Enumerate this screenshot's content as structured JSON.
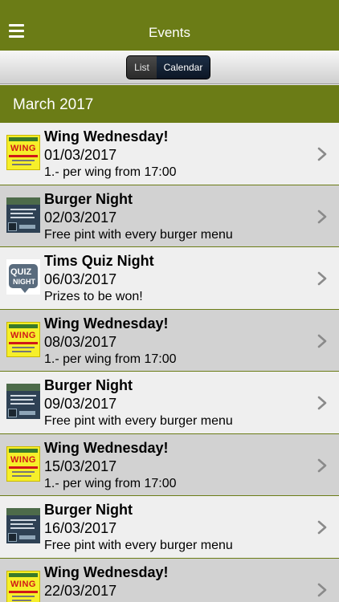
{
  "header": {
    "title": "Events",
    "menu_icon": "hamburger-menu-icon"
  },
  "segmented": {
    "list_label": "List",
    "calendar_label": "Calendar",
    "selected": "Calendar"
  },
  "section": {
    "title": "March 2017"
  },
  "events": [
    {
      "title": "Wing Wednesday!",
      "date": "01/03/2017",
      "desc": "1.- per wing from 17:00",
      "thumb": "wing"
    },
    {
      "title": "Burger Night",
      "date": "02/03/2017",
      "desc": "Free pint with every burger menu",
      "thumb": "burger"
    },
    {
      "title": "Tims Quiz Night",
      "date": "06/03/2017",
      "desc": "Prizes to be won!",
      "thumb": "quiz"
    },
    {
      "title": "Wing Wednesday!",
      "date": "08/03/2017",
      "desc": "1.- per wing from 17:00",
      "thumb": "wing"
    },
    {
      "title": "Burger Night",
      "date": "09/03/2017",
      "desc": "Free pint with every burger menu",
      "thumb": "burger"
    },
    {
      "title": "Wing Wednesday!",
      "date": "15/03/2017",
      "desc": "1.- per wing from 17:00",
      "thumb": "wing"
    },
    {
      "title": "Burger Night",
      "date": "16/03/2017",
      "desc": "Free pint with every burger menu",
      "thumb": "burger"
    },
    {
      "title": "Wing Wednesday!",
      "date": "22/03/2017",
      "desc": "",
      "thumb": "wing"
    }
  ],
  "thumb_text": {
    "wing": "WING",
    "quiz_top": "QUIZ",
    "quiz_bottom": "NIGHT"
  },
  "colors": {
    "brand_green": "#6b7c16",
    "row_light": "#efefef",
    "row_dark": "#d2d2d2"
  }
}
